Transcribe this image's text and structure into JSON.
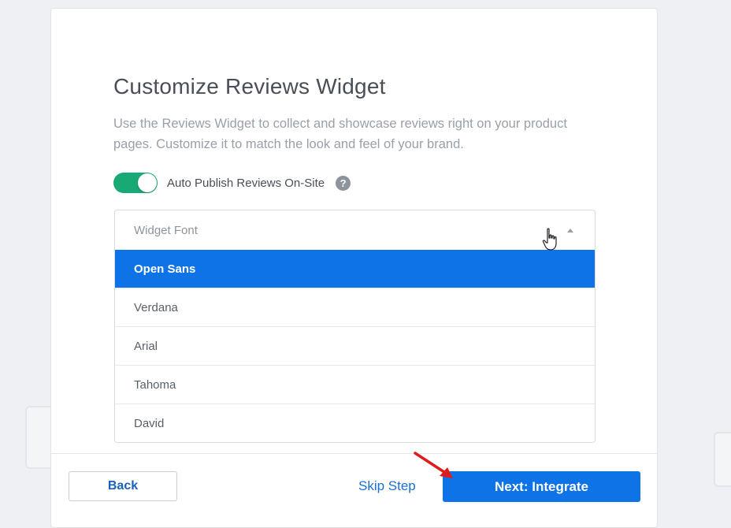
{
  "page": {
    "title": "Customize Reviews Widget",
    "description": "Use the Reviews Widget to collect and showcase reviews right on your product pages. Customize it to match the look and feel of your brand."
  },
  "toggle": {
    "label": "Auto Publish Reviews On-Site",
    "state": "on",
    "color": "#19a974",
    "help_icon": "?"
  },
  "dropdown": {
    "label": "Widget Font",
    "selected": "Open Sans",
    "options": [
      "Open Sans",
      "Verdana",
      "Arial",
      "Tahoma",
      "David"
    ],
    "highlight_color": "#0f73e8"
  },
  "footer": {
    "back_label": "Back",
    "skip_label": "Skip Step",
    "next_label": "Next: Integrate",
    "primary_color": "#0f73e8"
  },
  "annotation": {
    "arrow_color": "#e01b1b"
  }
}
